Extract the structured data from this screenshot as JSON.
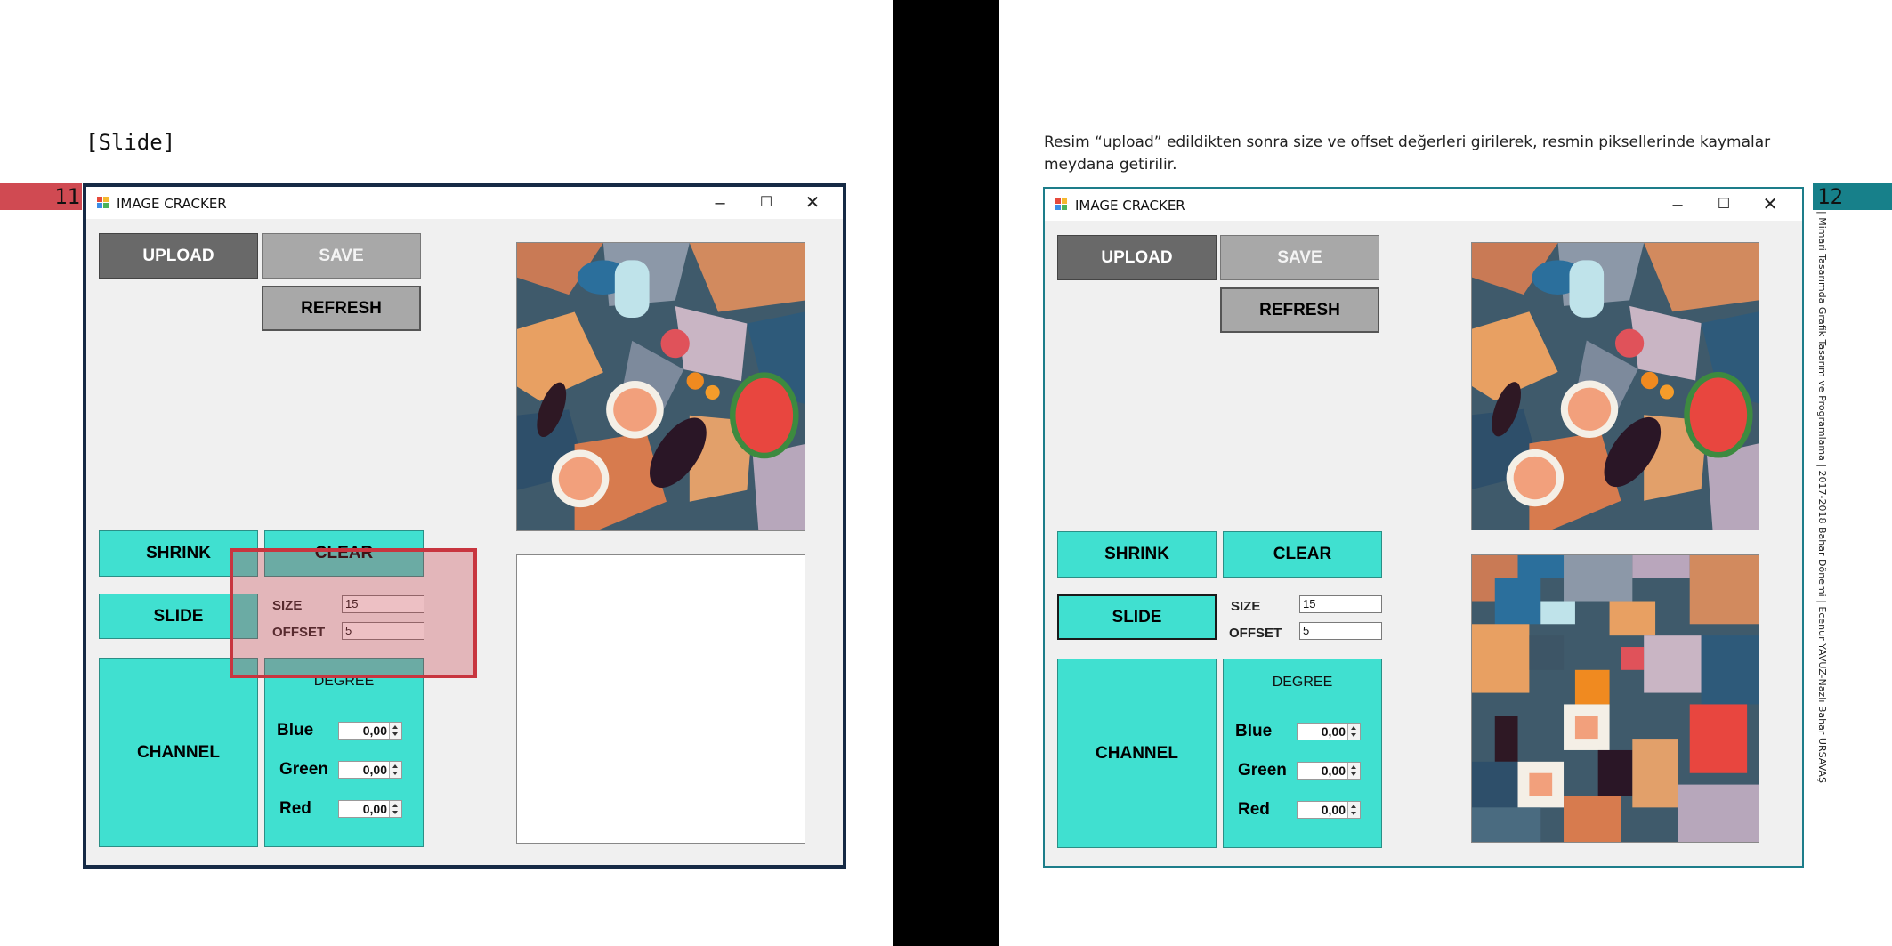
{
  "left_page": {
    "tag": "[Slide]",
    "page_number": "11",
    "window": {
      "title": "IMAGE CRACKER",
      "controls": {
        "minimize": "–",
        "maximize": "☐",
        "close": "✕"
      },
      "buttons": {
        "upload": "UPLOAD",
        "save": "SAVE",
        "refresh": "REFRESH",
        "shrink": "SHRINK",
        "clear": "CLEAR",
        "slide": "SLIDE",
        "channel": "CHANNEL"
      },
      "size_label": "SIZE",
      "offset_label": "OFFSET",
      "size_value": "15",
      "offset_value": "5",
      "degree_label": "DEGREE",
      "channels": [
        {
          "label": "Blue",
          "value": "0,00"
        },
        {
          "label": "Green",
          "value": "0,00"
        },
        {
          "label": "Red",
          "value": "0,00"
        }
      ]
    }
  },
  "right_page": {
    "caption": "Resim “upload” edildikten sonra size ve offset değerleri girilerek, resmin piksellerinde kaymalar meydana getirilir.",
    "page_number": "12",
    "vertical_text": "| Mimari Tasarımda Grafik Tasarım ve Programlama | 2017-2018 Bahar Dönemi | Ecenur YAVUZ-Nazlı Bahar URSAVAŞ",
    "window": {
      "title": "IMAGE CRACKER",
      "controls": {
        "minimize": "–",
        "maximize": "☐",
        "close": "✕"
      },
      "buttons": {
        "upload": "UPLOAD",
        "save": "SAVE",
        "refresh": "REFRESH",
        "shrink": "SHRINK",
        "clear": "CLEAR",
        "slide": "SLIDE",
        "channel": "CHANNEL"
      },
      "size_label": "SIZE",
      "offset_label": "OFFSET",
      "size_value": "15",
      "offset_value": "5",
      "degree_label": "DEGREE",
      "channels": [
        {
          "label": "Blue",
          "value": "0,00"
        },
        {
          "label": "Green",
          "value": "0,00"
        },
        {
          "label": "Red",
          "value": "0,00"
        }
      ]
    }
  },
  "colors": {
    "teal_button": "#40e0d0",
    "left_accent": "#d04a52",
    "right_accent": "#17808a",
    "highlight": "#c8353f"
  }
}
